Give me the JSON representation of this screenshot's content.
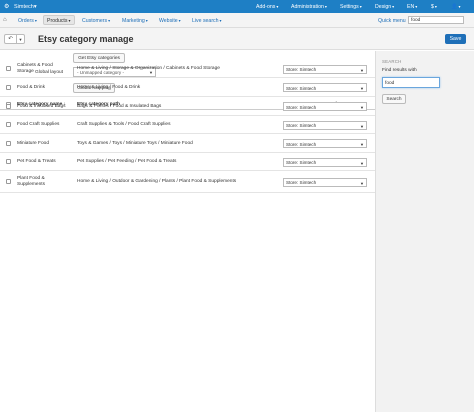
{
  "topbar": {
    "brand": "Simtech",
    "items": [
      "Add-ons",
      "Administration",
      "Settings",
      "Design",
      "EN",
      "$",
      ""
    ]
  },
  "nav": {
    "items": [
      "Orders",
      "Products",
      "Customers",
      "Marketing",
      "Website",
      "Live search"
    ],
    "active": "Products",
    "quick_menu": "Quick menu",
    "search_value": "food"
  },
  "page": {
    "title": "Etsy category manage",
    "save_label": "Save"
  },
  "controls": {
    "get_categories_label": "Get Etsy categories",
    "global_layout_label": "Global layout",
    "global_layout_value": "- Unmapped category -",
    "global_mapping_label": "Global mapping"
  },
  "table": {
    "headers": {
      "name": "Etsy category name",
      "name_sort": "↓",
      "path": "Etsy category path",
      "cart": "Cart category path"
    },
    "rows": [
      {
        "name": "Cabinets & Food\nStorage",
        "path": "Home & Living / Storage & Organization / Cabinets & Food Storage",
        "cart": "Store: Simtech"
      },
      {
        "name": "Food & Drink",
        "path": "Home & Living / Food & Drink",
        "cart": "Store: Simtech"
      },
      {
        "name": "Food & Insulated Bags",
        "path": "Bags & Purses / Food & Insulated Bags",
        "cart": "Store: Simtech"
      },
      {
        "name": "Food Craft Supplies",
        "path": "Craft Supplies & Tools / Food Craft Supplies",
        "cart": "Store: Simtech"
      },
      {
        "name": "Miniature Food",
        "path": "Toys & Games / Toys / Miniature Toys / Miniature Food",
        "cart": "Store: Simtech"
      },
      {
        "name": "Pet Food & Treats",
        "path": "Pet Supplies / Pet Feeding / Pet Food & Treats",
        "cart": "Store: Simtech"
      },
      {
        "name": "Plant Food &\nSupplements",
        "path": "Home & Living / Outdoor & Gardening / Plants / Plant Food & Supplements",
        "cart": "Store: Simtech"
      }
    ]
  },
  "sidebar": {
    "title": "SEARCH",
    "label": "Find results with",
    "input_value": "food",
    "button_label": "Search"
  },
  "colors": {
    "topbar": "#1e7fc5",
    "primary_button": "#1e6fb8",
    "link": "#1e6fb8"
  }
}
